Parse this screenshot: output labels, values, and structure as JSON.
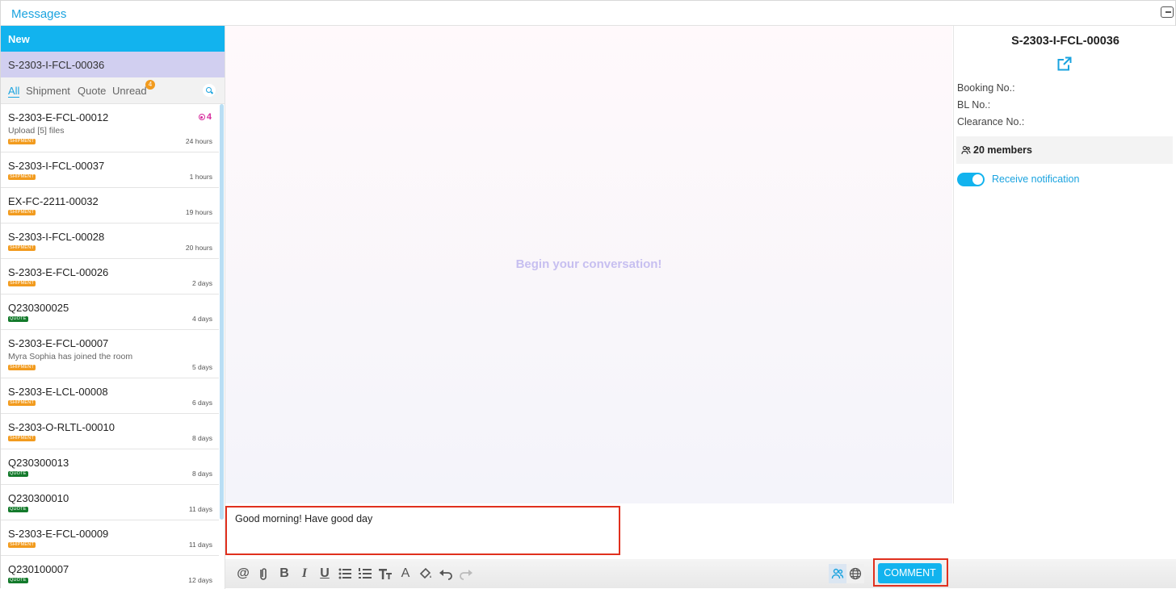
{
  "header": {
    "title": "Messages"
  },
  "left": {
    "new_label": "New",
    "current_room": "S-2303-I-FCL-00036",
    "filters": [
      "All",
      "Shipment",
      "Quote",
      "Unread"
    ],
    "unread_badge": "4",
    "rooms": [
      {
        "name": "S-2303-E-FCL-00012",
        "sub": "Upload [5] files",
        "tag": "SHIPMENT",
        "time": "24 hours",
        "unread": "4"
      },
      {
        "name": "S-2303-I-FCL-00037",
        "sub": "",
        "tag": "SHIPMENT",
        "time": "1 hours"
      },
      {
        "name": "EX-FC-2211-00032",
        "sub": "",
        "tag": "SHIPMENT",
        "time": "19 hours"
      },
      {
        "name": "S-2303-I-FCL-00028",
        "sub": "",
        "tag": "SHIPMENT",
        "time": "20 hours"
      },
      {
        "name": "S-2303-E-FCL-00026",
        "sub": "",
        "tag": "SHIPMENT",
        "time": "2 days"
      },
      {
        "name": "Q230300025",
        "sub": "",
        "tag": "QUOTE",
        "time": "4 days"
      },
      {
        "name": "S-2303-E-FCL-00007",
        "sub": "Myra Sophia has joined the room",
        "tag": "SHIPMENT",
        "time": "5 days"
      },
      {
        "name": "S-2303-E-LCL-00008",
        "sub": "",
        "tag": "SHIPMENT",
        "time": "6 days"
      },
      {
        "name": "S-2303-O-RLTL-00010",
        "sub": "",
        "tag": "SHIPMENT",
        "time": "8 days"
      },
      {
        "name": "Q230300013",
        "sub": "",
        "tag": "QUOTE",
        "time": "8 days"
      },
      {
        "name": "Q230300010",
        "sub": "",
        "tag": "QUOTE",
        "time": "11 days"
      },
      {
        "name": "S-2303-E-FCL-00009",
        "sub": "",
        "tag": "SHIPMENT",
        "time": "11 days"
      },
      {
        "name": "Q230100007",
        "sub": "",
        "tag": "QUOTE",
        "time": "12 days"
      }
    ]
  },
  "center": {
    "placeholder": "Begin your conversation!",
    "input_value": "Good morning! Have good day",
    "comment_label": "COMMENT",
    "toolbar_icons": [
      "mention-icon",
      "attach-icon",
      "bold-icon",
      "italic-icon",
      "underline-icon",
      "bullet-list-icon",
      "numbered-list-icon",
      "font-size-icon",
      "text-color-icon",
      "fill-color-icon",
      "undo-icon",
      "redo-icon",
      "people-icon",
      "globe-icon"
    ]
  },
  "right": {
    "title": "S-2303-I-FCL-00036",
    "booking_label": "Booking No.:",
    "bl_label": "BL No.:",
    "clearance_label": "Clearance No.:",
    "members": "20 members",
    "notification_label": "Receive notification",
    "notification_on": true
  },
  "colors": {
    "accent": "#12b3ee",
    "current_room_bg": "#d1cff0",
    "shipment_tag": "#f29b1e",
    "quote_tag": "#137a2b",
    "unread": "#d62b9c",
    "highlight_box": "#e0301e"
  }
}
